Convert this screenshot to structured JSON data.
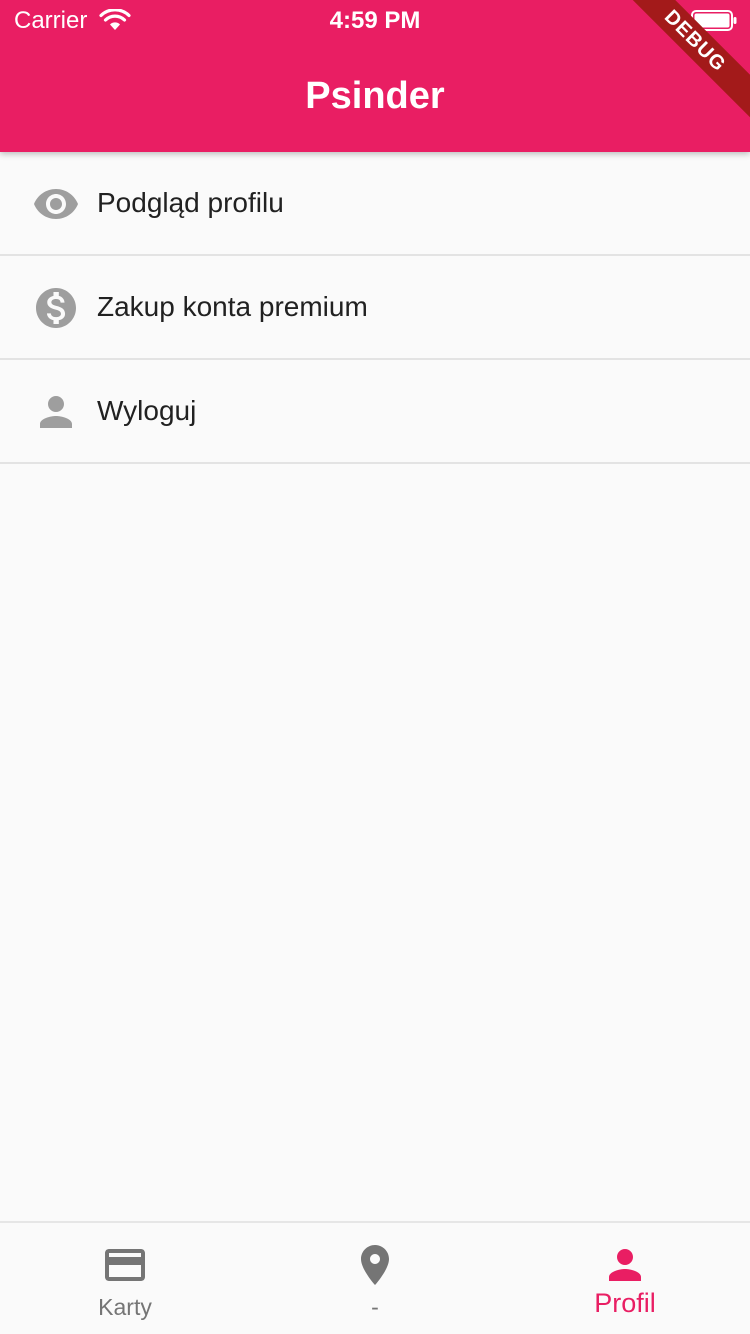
{
  "status_bar": {
    "carrier": "Carrier",
    "time": "4:59 PM"
  },
  "appbar": {
    "title": "Psinder",
    "color": "#e91e63"
  },
  "debug_banner": "DEBUG",
  "menu": {
    "items": [
      {
        "label": "Podgląd profilu",
        "icon": "eye-icon"
      },
      {
        "label": "Zakup konta premium",
        "icon": "dollar-circle-icon"
      },
      {
        "label": "Wyloguj",
        "icon": "person-icon"
      }
    ]
  },
  "bottom_nav": {
    "items": [
      {
        "label": "Karty",
        "icon": "credit-card-icon",
        "active": false
      },
      {
        "label": "-",
        "icon": "location-pin-icon",
        "active": false
      },
      {
        "label": "Profil",
        "icon": "person-icon",
        "active": true
      }
    ],
    "active_color": "#e91e63",
    "inactive_color": "#757575"
  }
}
